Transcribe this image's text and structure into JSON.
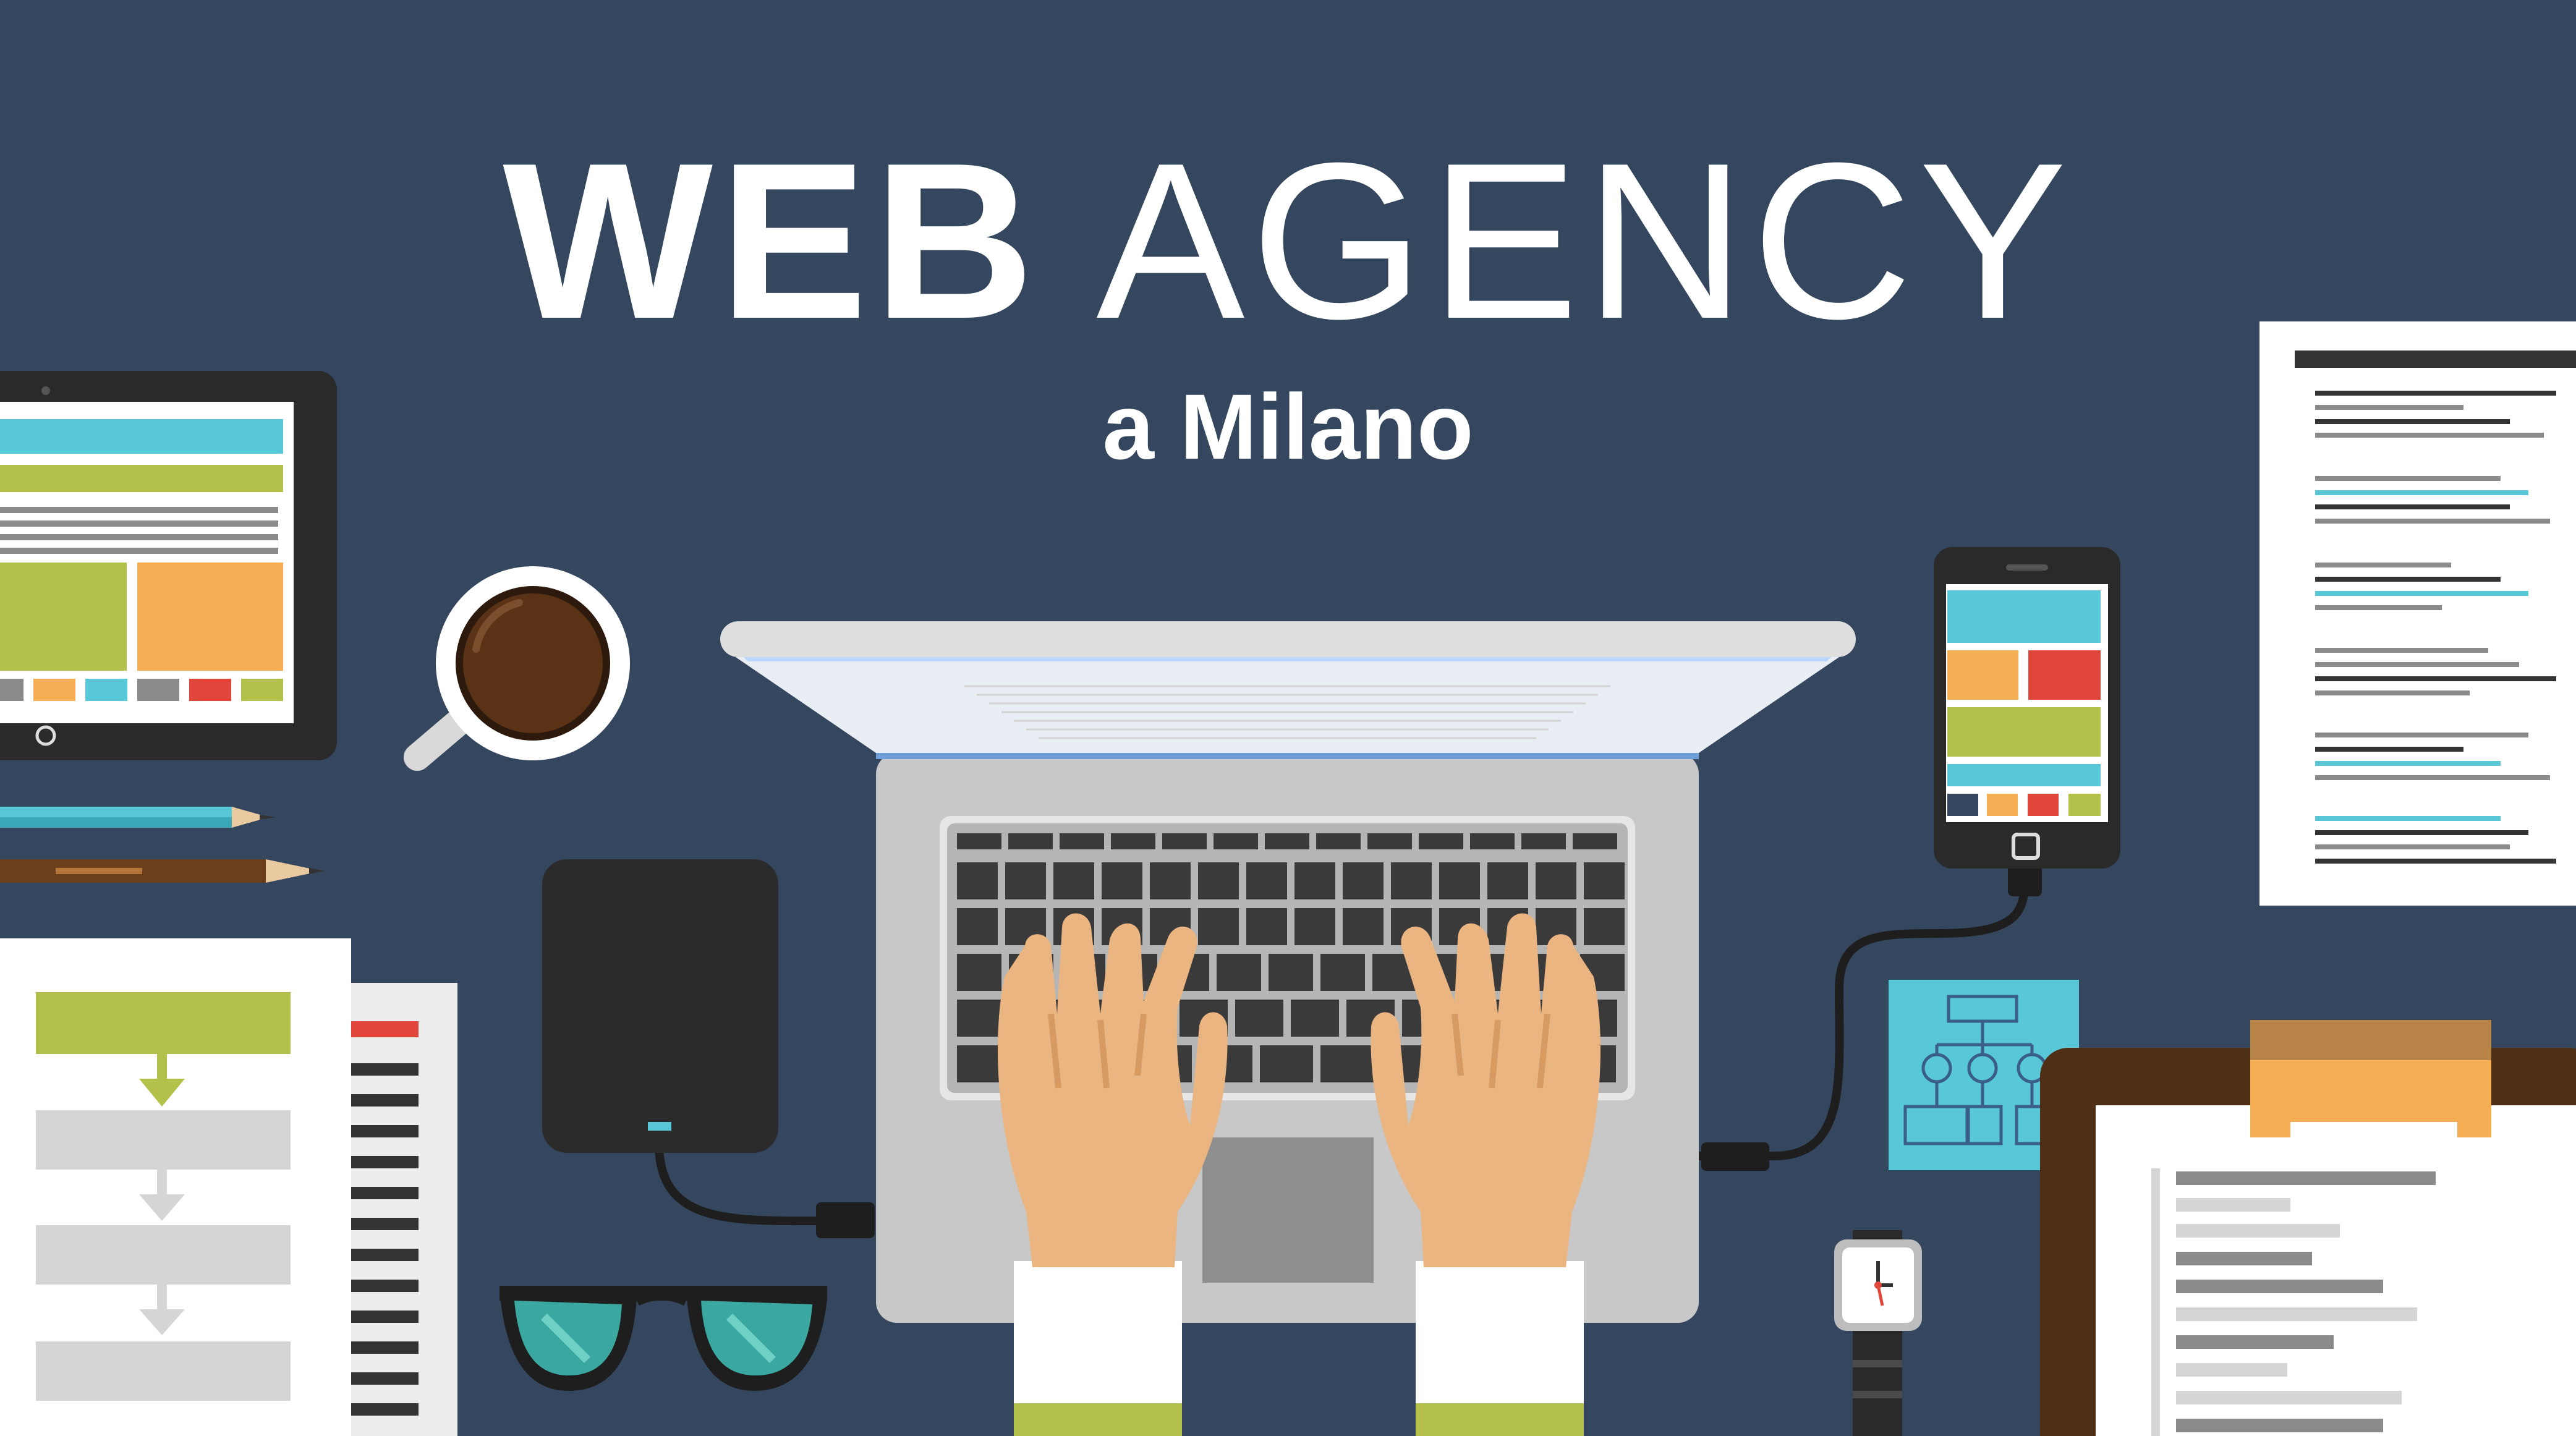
{
  "banner": {
    "title_bold": "WEB",
    "title_light": "AGENCY",
    "subtitle": "a Milano"
  },
  "colors": {
    "background": "#34475f",
    "text": "#ffffff",
    "accent_cyan": "#58c8d8",
    "accent_olive": "#b3c04a",
    "accent_orange": "#f6ae55",
    "accent_red": "#e0473a",
    "skin": "#ebb582",
    "laptop_body": "#c8c8c8",
    "keyboard_key": "#3a3a3a"
  },
  "icons": [
    "tablet-icon",
    "coffee-cup-icon",
    "pencil-icon",
    "pen-icon",
    "flowchart-paper-icon",
    "external-hard-drive-icon",
    "laptop-icon",
    "hands-icon",
    "smartphone-icon",
    "document-icon",
    "sticky-note-icon",
    "clipboard-icon",
    "wristwatch-icon",
    "glasses-icon"
  ]
}
